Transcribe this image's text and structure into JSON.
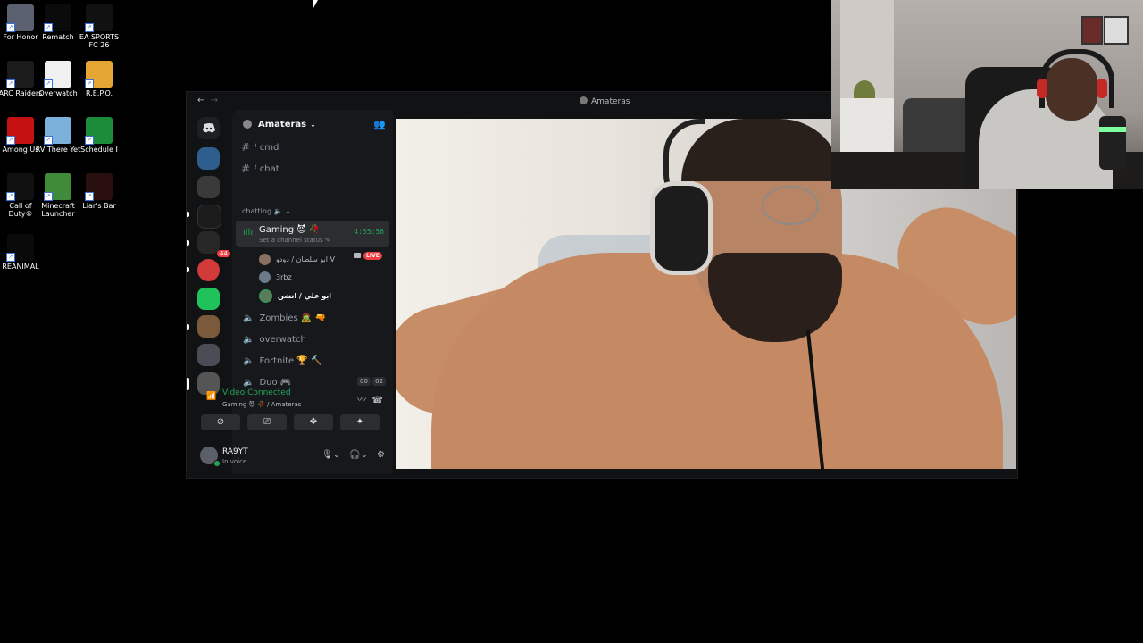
{
  "desktop": {
    "icons": [
      {
        "label": "For Honor",
        "color": "#5b6070"
      },
      {
        "label": "Rematch",
        "color": "#0b0b0b"
      },
      {
        "label": "EA SPORTS FC 26",
        "color": "#111111"
      },
      {
        "label": "ARC Raiders",
        "color": "#1b1b1b"
      },
      {
        "label": "Overwatch",
        "color": "#f0f0f0"
      },
      {
        "label": "R.E.P.O.",
        "color": "#e5a533"
      },
      {
        "label": "Among Us",
        "color": "#c51111"
      },
      {
        "label": "RV There Yet",
        "color": "#7ab0d9"
      },
      {
        "label": "Schedule I",
        "color": "#1c8c3a"
      },
      {
        "label": "Call of Duty®",
        "color": "#111111"
      },
      {
        "label": "Minecraft Launcher",
        "color": "#3f8b3a"
      },
      {
        "label": "Liar's Bar",
        "color": "#2a0f0f"
      },
      {
        "label": "REANIMAL",
        "color": "#0a0a0a"
      }
    ]
  },
  "window": {
    "title": "Amateras",
    "nav_back": "←",
    "nav_forward": "→"
  },
  "servers": {
    "badge": "44"
  },
  "guild": {
    "name": "Amateras"
  },
  "channels": {
    "text": [
      {
        "name": "ꜝ cmd"
      },
      {
        "name": "ꜝ chat"
      }
    ],
    "category": "chatting 🔈 ⌄",
    "active_voice": {
      "name": "Gaming 😈 🥀",
      "status": "Set a channel status ✎",
      "timer": "4:35:56"
    },
    "voice_users": [
      {
        "name": "ابو سلطان / دودو V",
        "live_label": "LIVE"
      },
      {
        "name": "3rbz"
      },
      {
        "name": "ابو علي / انشن"
      }
    ],
    "voice_channels": [
      {
        "name": "Zombies 🧟 🔫"
      },
      {
        "name": "overwatch"
      },
      {
        "name": "Fortnite 🏆 🔨"
      },
      {
        "name": "Duo 🎮"
      }
    ],
    "duo_count_a": "00",
    "duo_count_b": "02"
  },
  "voice_panel": {
    "title": "Video Connected",
    "subtitle": "Gaming 😈 🥀 / Amateras"
  },
  "user": {
    "name": "RA9YT",
    "status": "In voice"
  },
  "colors": {
    "green": "#23a559",
    "red": "#f23f43",
    "bg": "#111214"
  }
}
